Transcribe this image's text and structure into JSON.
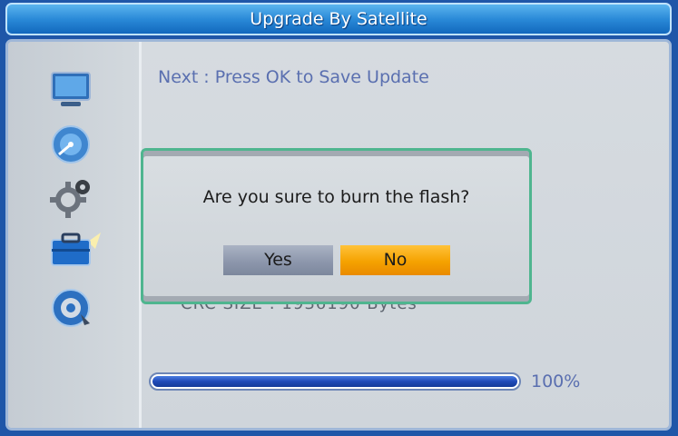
{
  "window": {
    "title": "Upgrade By Satellite"
  },
  "main": {
    "hint": "Next : Press OK to Save Update",
    "obscured_text": "CRC SIZE : 1936190 Bytes",
    "progress": {
      "value": 1.0,
      "label": "100%"
    }
  },
  "sidebar": {
    "icons": [
      "tv-icon",
      "satellite-dish-icon",
      "gear-icon",
      "toolbox-icon",
      "media-disc-icon"
    ],
    "selected": "toolbox-icon"
  },
  "dialog": {
    "message": "Are you sure to burn the flash?",
    "yes_label": "Yes",
    "no_label": "No",
    "focused": "No"
  },
  "colors": {
    "title_bar": "#2a8ad8",
    "panel": "#d3d9de",
    "dialog_border": "#4fb58f",
    "button_focus": "#f5a200",
    "button_normal": "#8d97ac",
    "progress": "#1f49b8"
  }
}
